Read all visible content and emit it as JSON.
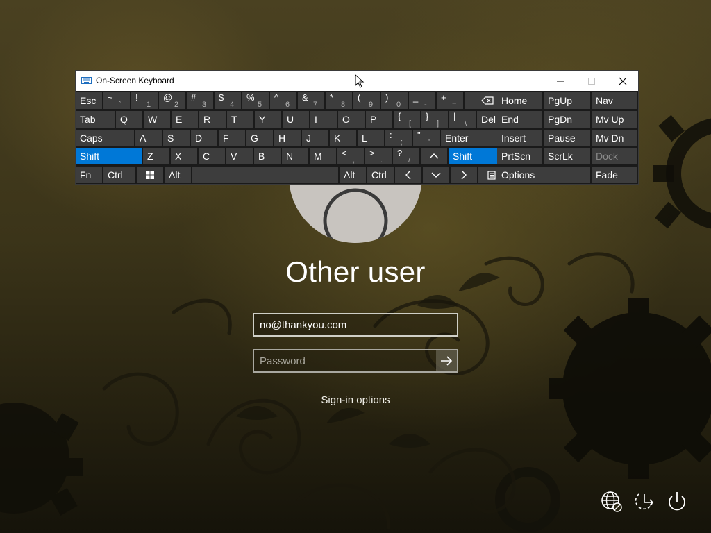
{
  "lock_screen": {
    "user_name": "Other user",
    "email_value": "no@thankyou.com",
    "password_placeholder": "Password",
    "signin_options_label": "Sign-in options"
  },
  "osk": {
    "title": "On-Screen Keyboard",
    "active_color": "#0078d7",
    "rows": [
      [
        {
          "id": "esc",
          "label": "Esc"
        },
        {
          "id": "tilde",
          "top": "~",
          "bot": "`"
        },
        {
          "id": "1",
          "top": "!",
          "bot": "1"
        },
        {
          "id": "2",
          "top": "@",
          "bot": "2"
        },
        {
          "id": "3",
          "top": "#",
          "bot": "3"
        },
        {
          "id": "4",
          "top": "$",
          "bot": "4"
        },
        {
          "id": "5",
          "top": "%",
          "bot": "5"
        },
        {
          "id": "6",
          "top": "^",
          "bot": "6"
        },
        {
          "id": "7",
          "top": "&",
          "bot": "7"
        },
        {
          "id": "8",
          "top": "*",
          "bot": "8"
        },
        {
          "id": "9",
          "top": "(",
          "bot": "9"
        },
        {
          "id": "0",
          "top": ")",
          "bot": "0"
        },
        {
          "id": "minus",
          "top": "_",
          "bot": "-"
        },
        {
          "id": "equals",
          "top": "+",
          "bot": "="
        },
        {
          "id": "backspace",
          "icon": "backspace-icon"
        }
      ],
      [
        {
          "id": "tab",
          "label": "Tab"
        },
        {
          "id": "q",
          "label": "Q"
        },
        {
          "id": "w",
          "label": "W"
        },
        {
          "id": "e",
          "label": "E"
        },
        {
          "id": "r",
          "label": "R"
        },
        {
          "id": "t",
          "label": "T"
        },
        {
          "id": "y",
          "label": "Y"
        },
        {
          "id": "u",
          "label": "U"
        },
        {
          "id": "i",
          "label": "I"
        },
        {
          "id": "o",
          "label": "O"
        },
        {
          "id": "p",
          "label": "P"
        },
        {
          "id": "lbracket",
          "top": "{",
          "bot": "["
        },
        {
          "id": "rbracket",
          "top": "}",
          "bot": "]"
        },
        {
          "id": "pipe",
          "top": "|",
          "bot": "\\"
        },
        {
          "id": "del",
          "label": "Del"
        }
      ],
      [
        {
          "id": "caps",
          "label": "Caps"
        },
        {
          "id": "a",
          "label": "A"
        },
        {
          "id": "s",
          "label": "S"
        },
        {
          "id": "d",
          "label": "D"
        },
        {
          "id": "f",
          "label": "F"
        },
        {
          "id": "g",
          "label": "G"
        },
        {
          "id": "h",
          "label": "H"
        },
        {
          "id": "j",
          "label": "J"
        },
        {
          "id": "k",
          "label": "K"
        },
        {
          "id": "l",
          "label": "L"
        },
        {
          "id": "semicolon",
          "top": ":",
          "bot": ";"
        },
        {
          "id": "quote",
          "top": "\"",
          "bot": "'"
        },
        {
          "id": "enter",
          "label": "Enter"
        }
      ],
      [
        {
          "id": "shift-left",
          "label": "Shift",
          "active": true
        },
        {
          "id": "z",
          "label": "Z"
        },
        {
          "id": "x",
          "label": "X"
        },
        {
          "id": "c",
          "label": "C"
        },
        {
          "id": "v",
          "label": "V"
        },
        {
          "id": "b",
          "label": "B"
        },
        {
          "id": "n",
          "label": "N"
        },
        {
          "id": "m",
          "label": "M"
        },
        {
          "id": "comma",
          "top": "<",
          "bot": ","
        },
        {
          "id": "period",
          "top": ">",
          "bot": "."
        },
        {
          "id": "slash",
          "top": "?",
          "bot": "/"
        },
        {
          "id": "up",
          "icon": "arrow-up-icon"
        },
        {
          "id": "shift-right",
          "label": "Shift",
          "active": true
        }
      ],
      [
        {
          "id": "fn",
          "label": "Fn"
        },
        {
          "id": "ctrl-left",
          "label": "Ctrl"
        },
        {
          "id": "win",
          "icon": "windows-logo-icon"
        },
        {
          "id": "alt-left",
          "label": "Alt"
        },
        {
          "id": "space",
          "label": ""
        },
        {
          "id": "alt-right",
          "label": "Alt"
        },
        {
          "id": "ctrl-right",
          "label": "Ctrl"
        },
        {
          "id": "left",
          "icon": "arrow-left-icon"
        },
        {
          "id": "down",
          "icon": "arrow-down-icon"
        },
        {
          "id": "right",
          "icon": "arrow-right-icon"
        },
        {
          "id": "menu",
          "icon": "context-menu-icon"
        }
      ]
    ],
    "nav_keys": [
      {
        "id": "home",
        "label": "Home"
      },
      {
        "id": "pgup",
        "label": "PgUp"
      },
      {
        "id": "nav",
        "label": "Nav"
      },
      {
        "id": "end",
        "label": "End"
      },
      {
        "id": "pgdn",
        "label": "PgDn"
      },
      {
        "id": "mvup",
        "label": "Mv Up"
      },
      {
        "id": "insert",
        "label": "Insert"
      },
      {
        "id": "pause",
        "label": "Pause"
      },
      {
        "id": "mvdn",
        "label": "Mv Dn"
      },
      {
        "id": "prtscn",
        "label": "PrtScn"
      },
      {
        "id": "scrlk",
        "label": "ScrLk"
      },
      {
        "id": "dock",
        "label": "Dock",
        "disabled": true
      },
      {
        "id": "options",
        "label": "Options"
      },
      {
        "id": "fade",
        "label": "Fade"
      }
    ]
  }
}
